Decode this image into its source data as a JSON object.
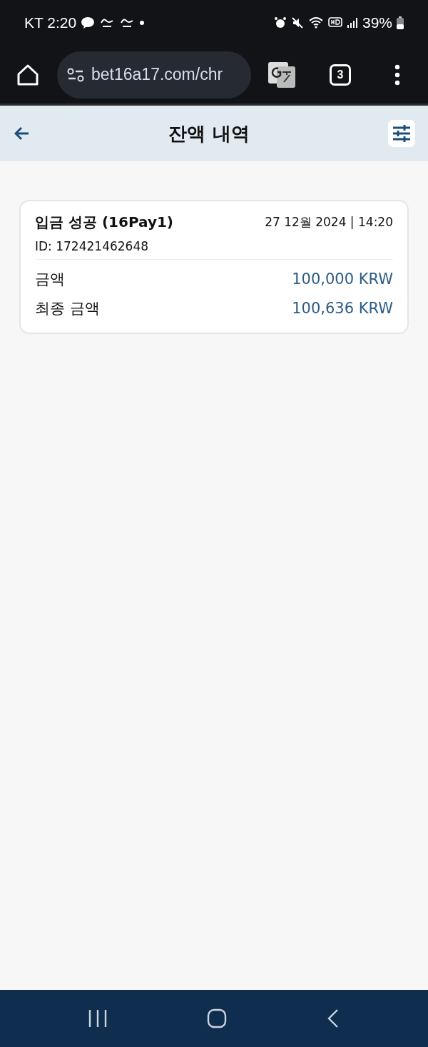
{
  "status_bar": {
    "carrier_time": "KT 2:20",
    "battery": "39%"
  },
  "browser": {
    "url": "bet16a17.com/chr",
    "tab_count": "3"
  },
  "header": {
    "title": "잔액 내역"
  },
  "transactions": [
    {
      "title": "입금 성공 (16Pay1)",
      "datetime": "27 12월 2024 | 14:20",
      "id": "ID: 172421462648",
      "lines": [
        {
          "label": "금액",
          "value": "100,000 KRW"
        },
        {
          "label": "최종 금액",
          "value": "100,636 KRW"
        }
      ]
    }
  ]
}
